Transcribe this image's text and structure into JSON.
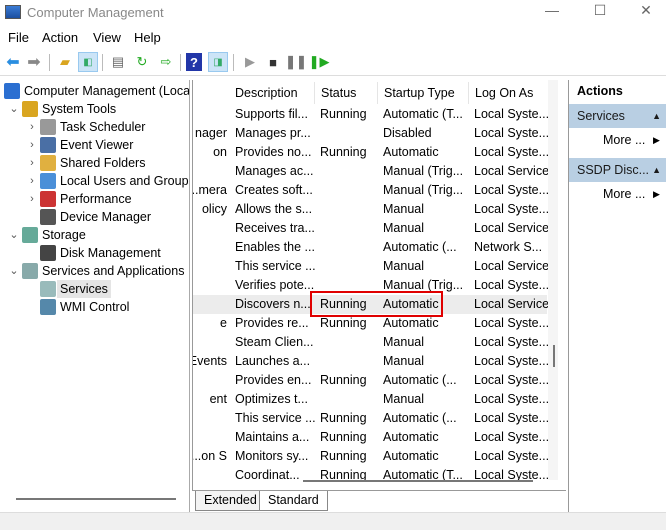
{
  "window": {
    "title": "Computer Management",
    "minimize": "—",
    "maximize": "☐",
    "close": "✕"
  },
  "menu": [
    "File",
    "Action",
    "View",
    "Help"
  ],
  "toolbar": {
    "icons": [
      "back-arrow-icon",
      "forward-arrow-icon",
      "up-folder-icon",
      "show-hide-tree-icon",
      "properties-icon",
      "refresh-icon",
      "export-list-icon",
      "help-icon",
      "show-hide-action-pane-icon",
      "start-service-icon",
      "stop-service-icon",
      "pause-service-icon",
      "resume-service-icon"
    ]
  },
  "tree": [
    {
      "label": "Computer Management (Local",
      "level": 0,
      "chev": ""
    },
    {
      "label": "System Tools",
      "level": 1,
      "chev": "⌄"
    },
    {
      "label": "Task Scheduler",
      "level": 2,
      "chev": "›"
    },
    {
      "label": "Event Viewer",
      "level": 2,
      "chev": "›"
    },
    {
      "label": "Shared Folders",
      "level": 2,
      "chev": "›"
    },
    {
      "label": "Local Users and Groups",
      "level": 2,
      "chev": "›"
    },
    {
      "label": "Performance",
      "level": 2,
      "chev": "›"
    },
    {
      "label": "Device Manager",
      "level": 2,
      "chev": ""
    },
    {
      "label": "Storage",
      "level": 1,
      "chev": "⌄"
    },
    {
      "label": "Disk Management",
      "level": 2,
      "chev": ""
    },
    {
      "label": "Services and Applications",
      "level": 1,
      "chev": "⌄"
    },
    {
      "label": "Services",
      "level": 2,
      "chev": "",
      "selected": true
    },
    {
      "label": "WMI Control",
      "level": 2,
      "chev": ""
    }
  ],
  "list": {
    "columns": [
      "Description",
      "Status",
      "Startup Type",
      "Log On As"
    ],
    "rows": [
      [
        "",
        "Supports fil...",
        "Running",
        "Automatic (T...",
        "Local Syste..."
      ],
      [
        "nager",
        "Manages pr...",
        "",
        "Disabled",
        "Local Syste..."
      ],
      [
        "on",
        "Provides no...",
        "Running",
        "Automatic",
        "Local Syste..."
      ],
      [
        "",
        "Manages ac...",
        "",
        "Manual (Trig...",
        "Local Service"
      ],
      [
        "mera...",
        "Creates soft...",
        "",
        "Manual (Trig...",
        "Local Syste..."
      ],
      [
        "olicy",
        "Allows the s...",
        "",
        "Manual",
        "Local Syste..."
      ],
      [
        "",
        "Receives tra...",
        "",
        "Manual",
        "Local Service"
      ],
      [
        "",
        "Enables the ...",
        "",
        "Automatic (...",
        "Network S..."
      ],
      [
        "",
        "This service ...",
        "",
        "Manual",
        "Local Service"
      ],
      [
        "",
        "Verifies pote...",
        "",
        "Manual (Trig...",
        "Local Syste..."
      ],
      [
        "",
        "Discovers n...",
        "Running",
        "Automatic",
        "Local Service"
      ],
      [
        "e",
        "Provides re...",
        "Running",
        "Automatic",
        "Local Syste..."
      ],
      [
        "",
        "Steam Clien...",
        "",
        "Manual",
        "Local Syste..."
      ],
      [
        "Events",
        "Launches a...",
        "",
        "Manual",
        "Local Syste..."
      ],
      [
        "",
        "Provides en...",
        "Running",
        "Automatic (...",
        "Local Syste..."
      ],
      [
        "ent",
        "Optimizes t...",
        "",
        "Manual",
        "Local Syste..."
      ],
      [
        "",
        "This service ...",
        "Running",
        "Automatic (...",
        "Local Syste..."
      ],
      [
        "",
        "Maintains a...",
        "Running",
        "Automatic",
        "Local Syste..."
      ],
      [
        "on S...",
        "Monitors sy...",
        "Running",
        "Automatic",
        "Local Syste..."
      ],
      [
        "",
        "Coordinat...",
        "Running",
        "Automatic (T...",
        "Local Syste..."
      ]
    ],
    "selected_row": 10
  },
  "tabs": [
    "Extended",
    "Standard"
  ],
  "actions": {
    "title": "Actions",
    "sections": [
      {
        "header": "Services",
        "more": "More ..."
      },
      {
        "header": "SSDP Disc...",
        "more": "More ..."
      }
    ]
  }
}
